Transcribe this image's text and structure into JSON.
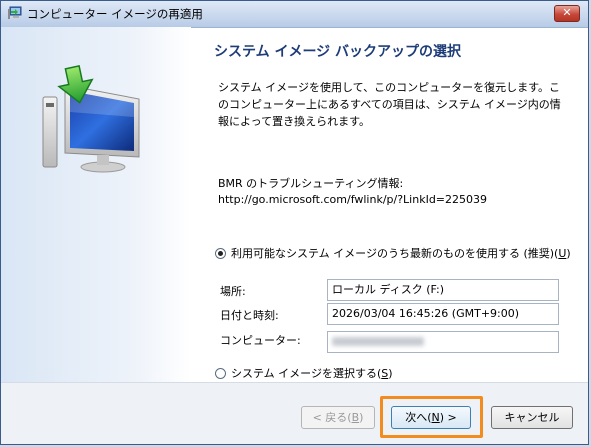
{
  "window": {
    "title": "コンピューター イメージの再適用",
    "close_label": "✕"
  },
  "heading": "システム イメージ バックアップの選択",
  "description": "システム イメージを使用して、このコンピューターを復元します。このコンピューター上にあるすべての項目は、システム イメージ内の情報によって置き換えられます。",
  "bmr": {
    "label": "BMR のトラブルシューティング情報:",
    "url": "http://go.microsoft.com/fwlink/p/?LinkId=225039"
  },
  "options": {
    "latest": {
      "label": "利用可能なシステム イメージのうち最新のものを使用する (推奨)(",
      "accel": "U",
      "tail": ")",
      "selected": true
    },
    "select": {
      "label": "システム イメージを選択する(",
      "accel": "S",
      "tail": ")",
      "selected": false
    }
  },
  "fields": {
    "location": {
      "label": "場所:",
      "value": "ローカル ディスク (F:)"
    },
    "datetime": {
      "label": "日付と時刻:",
      "value": "2026/03/04 16:45:26 (GMT+9:00)"
    },
    "computer": {
      "label": "コンピューター:",
      "value": ""
    }
  },
  "buttons": {
    "back": {
      "label": "< 戻る(",
      "accel": "B",
      "tail": ")",
      "enabled": false
    },
    "next": {
      "label": "次へ(",
      "accel": "N",
      "tail": ") >",
      "enabled": true
    },
    "cancel": {
      "label": "キャンセル",
      "enabled": true
    }
  },
  "colors": {
    "heading": "#1e3c78",
    "highlight": "#f28c1e",
    "close": "#c7483a"
  }
}
